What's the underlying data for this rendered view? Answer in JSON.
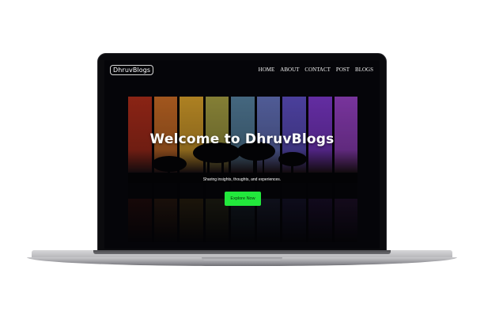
{
  "site": {
    "logo": "DhruvBlogs",
    "nav": [
      "HOME",
      "ABOUT",
      "CONTACT",
      "POST",
      "BLOGS"
    ]
  },
  "hero": {
    "title": "Welcome to DhruvBlogs",
    "subtitle": "Sharing insights, thoughts, and experiences.",
    "cta_label": "Explore Now"
  },
  "colors": {
    "accent": "#22e83c",
    "strip_skies": [
      "#c0321e",
      "#e0782a",
      "#f0b230",
      "#b7b04a",
      "#5f8fb0",
      "#6f7fd0",
      "#6858d8",
      "#8a3ee0",
      "#a648d8"
    ]
  }
}
